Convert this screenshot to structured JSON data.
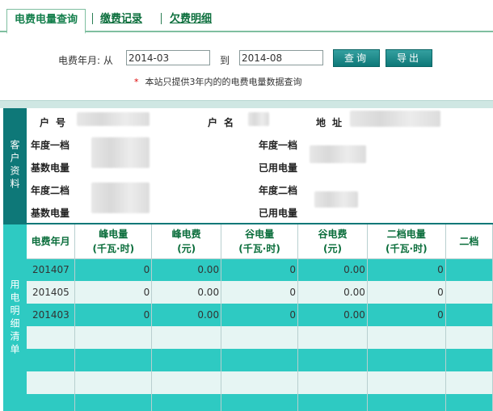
{
  "tabs": [
    {
      "label": "电费电量查询",
      "active": true
    },
    {
      "label": "缴费记录",
      "active": false
    },
    {
      "label": "欠费明细",
      "active": false
    }
  ],
  "search": {
    "label_month": "电费年月: 从",
    "from_value": "2014-03",
    "to_label": "到",
    "to_value": "2014-08",
    "query_button": "查询",
    "export_button": "导出",
    "note_star": "*",
    "note": "本站只提供3年内的的电费电量数据查询"
  },
  "customer": {
    "side_label": "客户资料",
    "account_label": "户号",
    "name_label": "户名",
    "address_label": "地址",
    "tier1_base_label": "年度一档",
    "tier1_base_label2": "基数电量",
    "tier1_used_label": "年度一档",
    "tier1_used_label2": "已用电量",
    "tier2_base_label": "年度二档",
    "tier2_base_label2": "基数电量",
    "tier2_used_label": "年度二档",
    "tier2_used_label2": "已用电量"
  },
  "detail": {
    "side_label": "用电明细清单",
    "columns": [
      {
        "line1": "电费年月",
        "line2": ""
      },
      {
        "line1": "峰电量",
        "line2": "(千瓦·时)"
      },
      {
        "line1": "峰电费",
        "line2": "(元)"
      },
      {
        "line1": "谷电量",
        "line2": "(千瓦·时)"
      },
      {
        "line1": "谷电费",
        "line2": "(元)"
      },
      {
        "line1": "二档电量",
        "line2": "(千瓦·时)"
      },
      {
        "line1": "二档",
        "line2": ""
      }
    ],
    "rows": [
      [
        "201407",
        "0",
        "0.00",
        "0",
        "0.00",
        "0",
        ""
      ],
      [
        "201405",
        "0",
        "0.00",
        "0",
        "0.00",
        "0",
        ""
      ],
      [
        "201403",
        "0",
        "0.00",
        "0",
        "0.00",
        "0",
        ""
      ],
      [
        "",
        "",
        "",
        "",
        "",
        "",
        ""
      ],
      [
        "",
        "",
        "",
        "",
        "",
        "",
        ""
      ],
      [
        "",
        "",
        "",
        "",
        "",
        "",
        ""
      ],
      [
        "",
        "",
        "",
        "",
        "",
        "",
        ""
      ]
    ]
  }
}
